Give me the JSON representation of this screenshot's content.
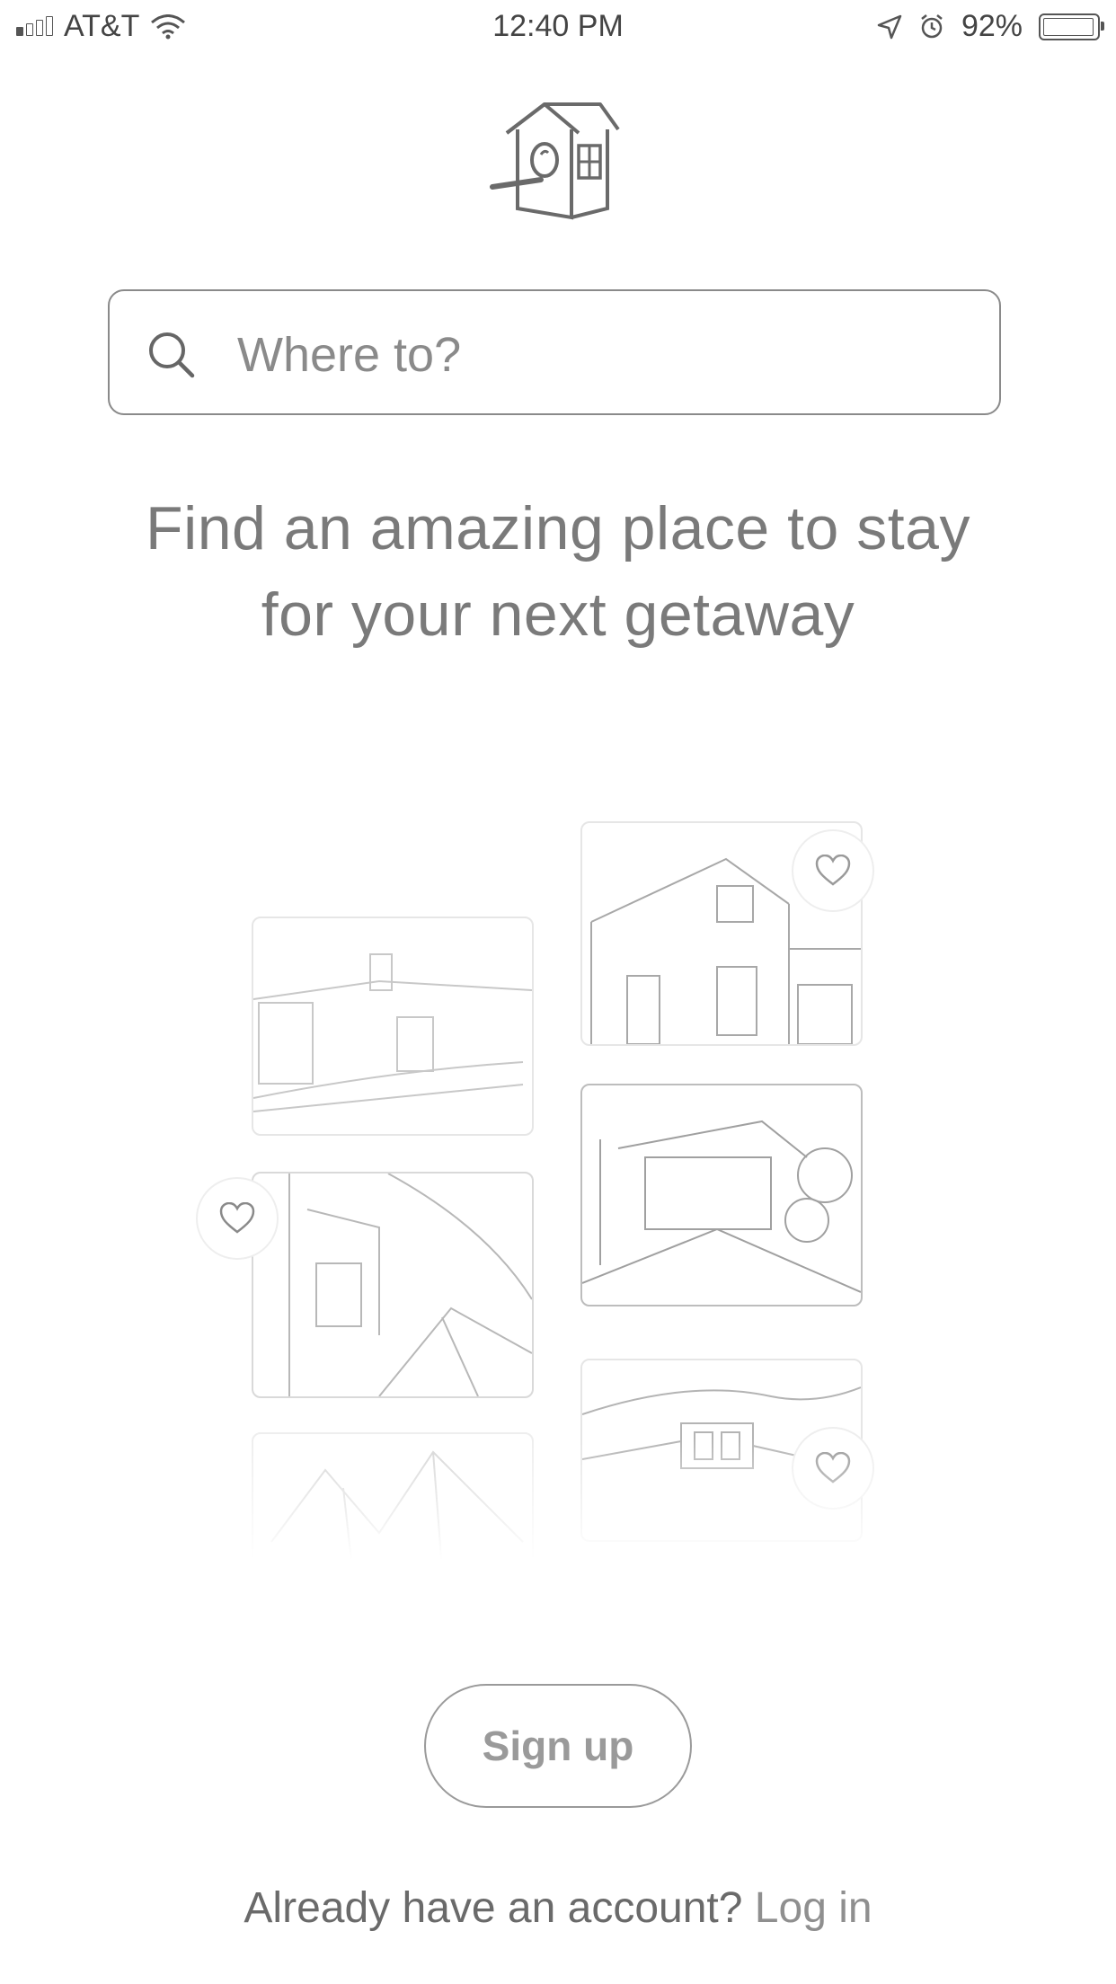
{
  "status_bar": {
    "carrier": "AT&T",
    "time": "12:40 PM",
    "battery_percent": "92%"
  },
  "search": {
    "placeholder": "Where to?"
  },
  "tagline": {
    "line1": "Find an amazing place to stay",
    "line2": "for your next getaway"
  },
  "buttons": {
    "sign_up": "Sign up"
  },
  "login": {
    "prompt": "Already have an account?",
    "link": "Log in"
  },
  "icons": [
    "signal-icon",
    "wifi-icon",
    "location-arrow-icon",
    "alarm-icon",
    "battery-icon",
    "birdhouse-logo-icon",
    "search-icon",
    "heart-icon"
  ]
}
